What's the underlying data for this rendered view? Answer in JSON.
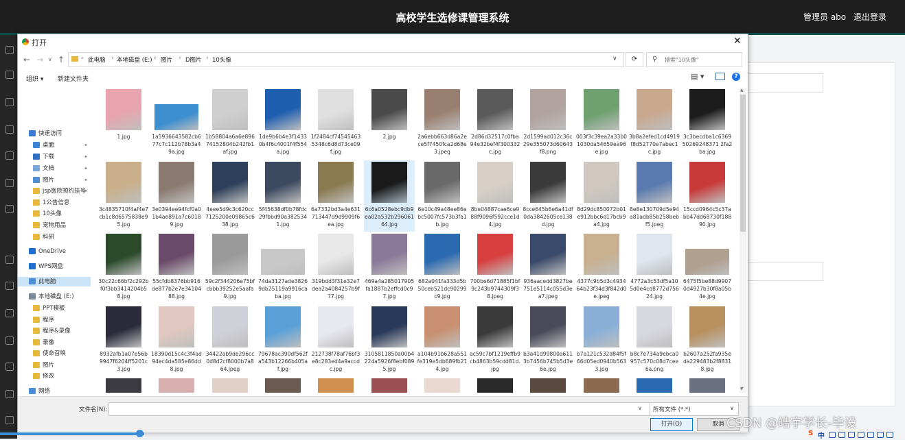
{
  "app": {
    "title": "高校学生选修课管理系统",
    "user": "管理员 abo",
    "logout": "退出登录"
  },
  "dialog": {
    "title": "打开",
    "close": "✕",
    "breadcrumb": [
      "此电脑",
      "本地磁盘 (E:)",
      "图片",
      "D图片",
      "10头像"
    ],
    "search_placeholder": "搜索\"10头像\"",
    "toolbar": {
      "organize": "组织 ▾",
      "new_folder": "新建文件夹"
    },
    "sidebar": [
      {
        "label": "快速访问",
        "icon": "star-icon",
        "color": "#3b7bd4",
        "indent": 0
      },
      {
        "label": "桌面",
        "icon": "desktop-icon",
        "color": "#3b86d6",
        "indent": 1,
        "pin": true
      },
      {
        "label": "下载",
        "icon": "download-icon",
        "color": "#2f6fc2",
        "indent": 1,
        "pin": true
      },
      {
        "label": "文档",
        "icon": "document-icon",
        "color": "#7aa6d9",
        "indent": 1,
        "pin": true
      },
      {
        "label": "图片",
        "icon": "pictures-icon",
        "color": "#4f8fd0",
        "indent": 1,
        "pin": true
      },
      {
        "label": "jsp医院预约挂号",
        "icon": "folder-icon",
        "color": "#e8b83c",
        "indent": 1,
        "pin": true
      },
      {
        "label": "1公告信息",
        "icon": "folder-icon",
        "color": "#e8b83c",
        "indent": 1
      },
      {
        "label": "10头像",
        "icon": "folder-icon",
        "color": "#e8b83c",
        "indent": 1
      },
      {
        "label": "宠物用品",
        "icon": "folder-icon",
        "color": "#e8b83c",
        "indent": 1
      },
      {
        "label": "科研",
        "icon": "folder-icon",
        "color": "#e8b83c",
        "indent": 1
      },
      {
        "label": "OneDrive",
        "icon": "cloud-icon",
        "color": "#1e6fd0",
        "indent": 0
      },
      {
        "label": "WPS网盘",
        "icon": "cloud-icon",
        "color": "#1e6fd0",
        "indent": 0
      },
      {
        "label": "此电脑",
        "icon": "computer-icon",
        "color": "#4b8fd8",
        "indent": 0,
        "selected": true
      },
      {
        "label": "本地磁盘 (E:)",
        "icon": "drive-icon",
        "color": "#7b8a99",
        "indent": 0
      },
      {
        "label": "PPT模板",
        "icon": "folder-icon",
        "color": "#e8b83c",
        "indent": 1
      },
      {
        "label": "程序",
        "icon": "folder-icon",
        "color": "#e8b83c",
        "indent": 1
      },
      {
        "label": "程序&录像",
        "icon": "folder-icon",
        "color": "#e8b83c",
        "indent": 1
      },
      {
        "label": "录像",
        "icon": "folder-icon",
        "color": "#e8b83c",
        "indent": 1
      },
      {
        "label": "使命召唤",
        "icon": "folder-icon",
        "color": "#e8b83c",
        "indent": 1
      },
      {
        "label": "图片",
        "icon": "folder-icon",
        "color": "#e8b83c",
        "indent": 1
      },
      {
        "label": "修改",
        "icon": "folder-icon",
        "color": "#e8b83c",
        "indent": 1
      },
      {
        "label": "网络",
        "icon": "network-icon",
        "color": "#4b8fd8",
        "indent": 0
      }
    ],
    "files": [
      {
        "name": "1.jpg",
        "color": "#e8a4ae"
      },
      {
        "name": "1a5936643582cb677c7c112b78b3a49a.jpg",
        "color": "#3d8fd0",
        "wide": true
      },
      {
        "name": "1b58804a6a6e89674152804b242fb1af.jpg",
        "color": "#cfcfcf"
      },
      {
        "name": "1de9b6b4e3f14330b4f6c4001f4f554a.jpg",
        "color": "#1f5fb0"
      },
      {
        "name": "1f2484cf745454635348c6d8d73ce09f.jpg",
        "color": "#e0e0e0"
      },
      {
        "name": "2.jpg",
        "color": "#4a4a4a"
      },
      {
        "name": "2a6ebb663d86a2ece5f7450fca2d68e3.jpeg",
        "color": "#9a8070"
      },
      {
        "name": "2d86d32517c0fba94e32bef4f300332c.jpg",
        "color": "#5a5a5a"
      },
      {
        "name": "2d1599ad012c36c29e355073d60643f8.png",
        "color": "#b0a3a0"
      },
      {
        "name": "003f3c39ea2a33b01030da54659ea96e.jpg",
        "color": "#6fa070"
      },
      {
        "name": "3b8a2efed1cd4919f8d52770e7abec1c.jpg",
        "color": "#c9a890"
      },
      {
        "name": "3c3becdba1c636950269248371 2fa2ba.jpg",
        "color": "#1c1c1c"
      },
      {
        "name": "3c4835710f4af4e7cb1c8d6575838e95.jpg",
        "color": "#c9b08a"
      },
      {
        "name": "3e0394ee94fcf0a01b4ae891a7c60189.jpg",
        "color": "#8a7a70"
      },
      {
        "name": "4eee5d9c3c620cc7125200e09865c638.jpg",
        "color": "#2d3f5a"
      },
      {
        "name": "5f45638df0b78fdc29fbbd90a3825341.jpg",
        "color": "#3c4a60"
      },
      {
        "name": "6a7332bd3a4e631713447d9d9909f6ea.jpg",
        "color": "#8a7a50"
      },
      {
        "name": "6c6a0528ebc9db9ea02a532b29606164.jpg",
        "color": "#1a1a1a",
        "selected": true
      },
      {
        "name": "6e10c49a48ee86ebc5007fc573b3fa1b.jpg",
        "color": "#6a6a6a"
      },
      {
        "name": "8be04887cae6ce988f9096f592cce1d4.jpg",
        "color": "#d8d0c8"
      },
      {
        "name": "8cce645b6e6a41df0da3842605ce138d.jpg",
        "color": "#3a3a3a"
      },
      {
        "name": "8d29dc850072b01e912bbc6d17bcb9a4.jpg",
        "color": "#d0c8c0"
      },
      {
        "name": "8e8e130709d5e94a81adb85b258bebf5.jpeg",
        "color": "#5a7ab0"
      },
      {
        "name": "15ccd0964c5c37abb47dd68730f18890.jpg",
        "color": "#c83a3a"
      },
      {
        "name": "30c22c66bf2c292bf0f3bb3414204b58.jpg",
        "color": "#2a4a2a"
      },
      {
        "name": "55cfdb8376bb916de877b2e7e3410488.jpg",
        "color": "#6a4a6a"
      },
      {
        "name": "59c2f344206e75bfcbbb39252e5aafa9.jpg",
        "color": "#9a9a9a"
      },
      {
        "name": "74da3127ade38269db25119a9916caba.jpg",
        "color": "#c8c8c8",
        "wide": true
      },
      {
        "name": "319bdd3f31e32e7dea2a4084257b9f77.jpg",
        "color": "#e8e8e8"
      },
      {
        "name": "469a4a285017905fa1887b2effcd0c97.jpg",
        "color": "#8a7a9a"
      },
      {
        "name": "682a041fa333d5b50ceb521dc90299c9.jpg",
        "color": "#2a6ab0"
      },
      {
        "name": "700be6d71885f1bf9c243b9744309f38.jpeg",
        "color": "#d84040"
      },
      {
        "name": "936aacedd3827be751e5114c055d3ea7.jpeg",
        "color": "#3a4a6a"
      },
      {
        "name": "4377c9b5d3c493464b23f34d3f842d0e.jpeg",
        "color": "#c8b090"
      },
      {
        "name": "4772a3c53df5a105d0e4cd8772d75624.jpg",
        "color": "#dfe6ee"
      },
      {
        "name": "6475f5be88d99070d4927b30f8a05b4e.jpg",
        "color": "#b0a090",
        "wide": true
      },
      {
        "name": "8932afb1a07e56b9947f6204ff5201c3.jpg",
        "color": "#2a2a3a"
      },
      {
        "name": "18390d15c4c3f4ad94ec4da585e86dd8.jpg",
        "color": "#e0c8c0"
      },
      {
        "name": "34422ab9de296cc0d8d2cf8000b7a864.jpeg",
        "color": "#d0d0d8"
      },
      {
        "name": "79678ac390df562fa543b12266b405af.jpg",
        "color": "#5aa0d8"
      },
      {
        "name": "212738f78af76bf3e8c283ed4a9accdc.jpg",
        "color": "#e8e8f0"
      },
      {
        "name": "3105811850a00b4224a5926f8ebf0895.jpg",
        "color": "#2a3a5a"
      },
      {
        "name": "a104b91b628a551fe319e5db689fb214.jpg",
        "color": "#c89070"
      },
      {
        "name": "ac59c7bf1219effb9cb4863b59cdd81d.jpg",
        "color": "#3a3a3a"
      },
      {
        "name": "b3a41d99800a6113b7456b745b5d3e6e.jpg",
        "color": "#4a4a5a"
      },
      {
        "name": "b7a121c532d84f5f66d05ed0940b5633.jpg",
        "color": "#8ab0d8"
      },
      {
        "name": "b8c7e734a9ebca0957c570c08d7cee6a.png",
        "color": "#d8d8e0"
      },
      {
        "name": "b2607a252fa935eda229483b2f88318.jpg",
        "color": "#b89060"
      },
      {
        "name": "",
        "color": "#3a3a40"
      },
      {
        "name": "",
        "color": "#d8b0b0"
      },
      {
        "name": "",
        "color": "#e0d0c8"
      },
      {
        "name": "",
        "color": "#6a5a50"
      },
      {
        "name": "",
        "color": "#d09050"
      },
      {
        "name": "",
        "color": "#9a5050"
      },
      {
        "name": "",
        "color": "#e8d8d0"
      },
      {
        "name": "",
        "color": "#2a2a2a"
      },
      {
        "name": "",
        "color": "#5a4a40"
      },
      {
        "name": "",
        "color": "#8a6a50"
      },
      {
        "name": "",
        "color": "#2a6ab0"
      },
      {
        "name": "",
        "color": "#6a7080"
      }
    ],
    "filename_label": "文件名(N):",
    "filename_value": "",
    "file_type": "所有文件 (*.*)",
    "open_button": "打开(O)",
    "cancel_button": "取消"
  },
  "watermark": "CSDN @皓宇学长-毕设",
  "tray": {
    "ime": "中"
  }
}
